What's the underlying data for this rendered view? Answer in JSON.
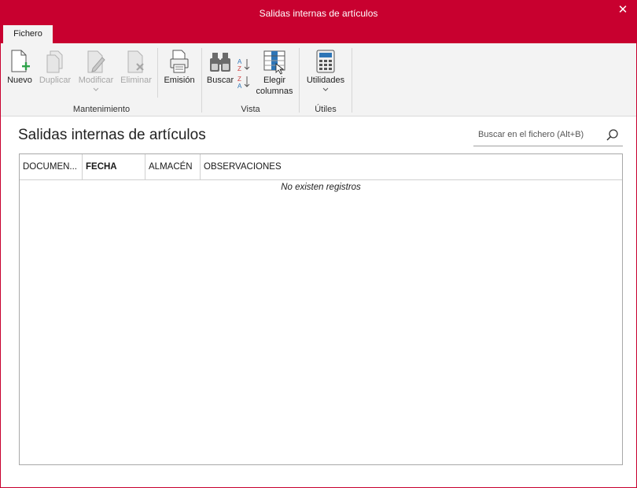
{
  "window": {
    "title": "Salidas internas de artículos",
    "close_glyph": "✕"
  },
  "tabs": [
    {
      "label": "Fichero"
    }
  ],
  "ribbon": {
    "groups": {
      "mantenimiento": "Mantenimiento",
      "vista": "Vista",
      "utiles": "Útiles"
    },
    "buttons": {
      "nuevo": "Nuevo",
      "duplicar": "Duplicar",
      "modificar": "Modificar",
      "eliminar": "Eliminar",
      "emision": "Emisión",
      "buscar": "Buscar",
      "elegir_columnas_1": "Elegir",
      "elegir_columnas_2": "columnas",
      "utilidades": "Utilidades"
    }
  },
  "content": {
    "title": "Salidas internas de artículos",
    "search_placeholder": "Buscar en el fichero (Alt+B)"
  },
  "grid": {
    "columns": [
      "DOCUMEN...",
      "FECHA",
      "ALMACÉN",
      "OBSERVACIONES"
    ],
    "empty_message": "No existen registros"
  },
  "colors": {
    "accent": "#c8002f",
    "ribbon_bg": "#f3f3f3",
    "icon_green": "#2fa34a",
    "icon_blue": "#2e75b6"
  }
}
